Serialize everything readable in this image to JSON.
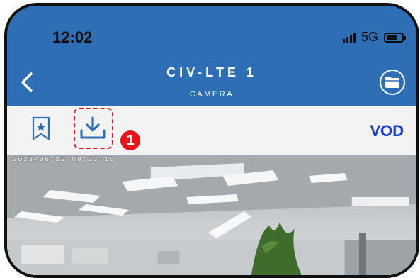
{
  "status_bar": {
    "time": "12:02",
    "network": "5G",
    "battery_level": 0.6
  },
  "header": {
    "title": "CIV-LTE 1",
    "subtitle": "CAMERA",
    "back_icon": "chevron-left-icon",
    "folder_icon": "folder-icon"
  },
  "toolbar": {
    "bookmark_icon": "bookmark-star-icon",
    "download_icon": "download-icon",
    "step_number": "1",
    "vod_label": "VOD"
  },
  "camera": {
    "timestamp": "2023/06/19 08:23:16"
  },
  "colors": {
    "header_bg": "#2e6eb5",
    "toolbar_bg": "#f3f3f3",
    "accent": "#1a3fd6",
    "highlight": "#e8141a"
  }
}
